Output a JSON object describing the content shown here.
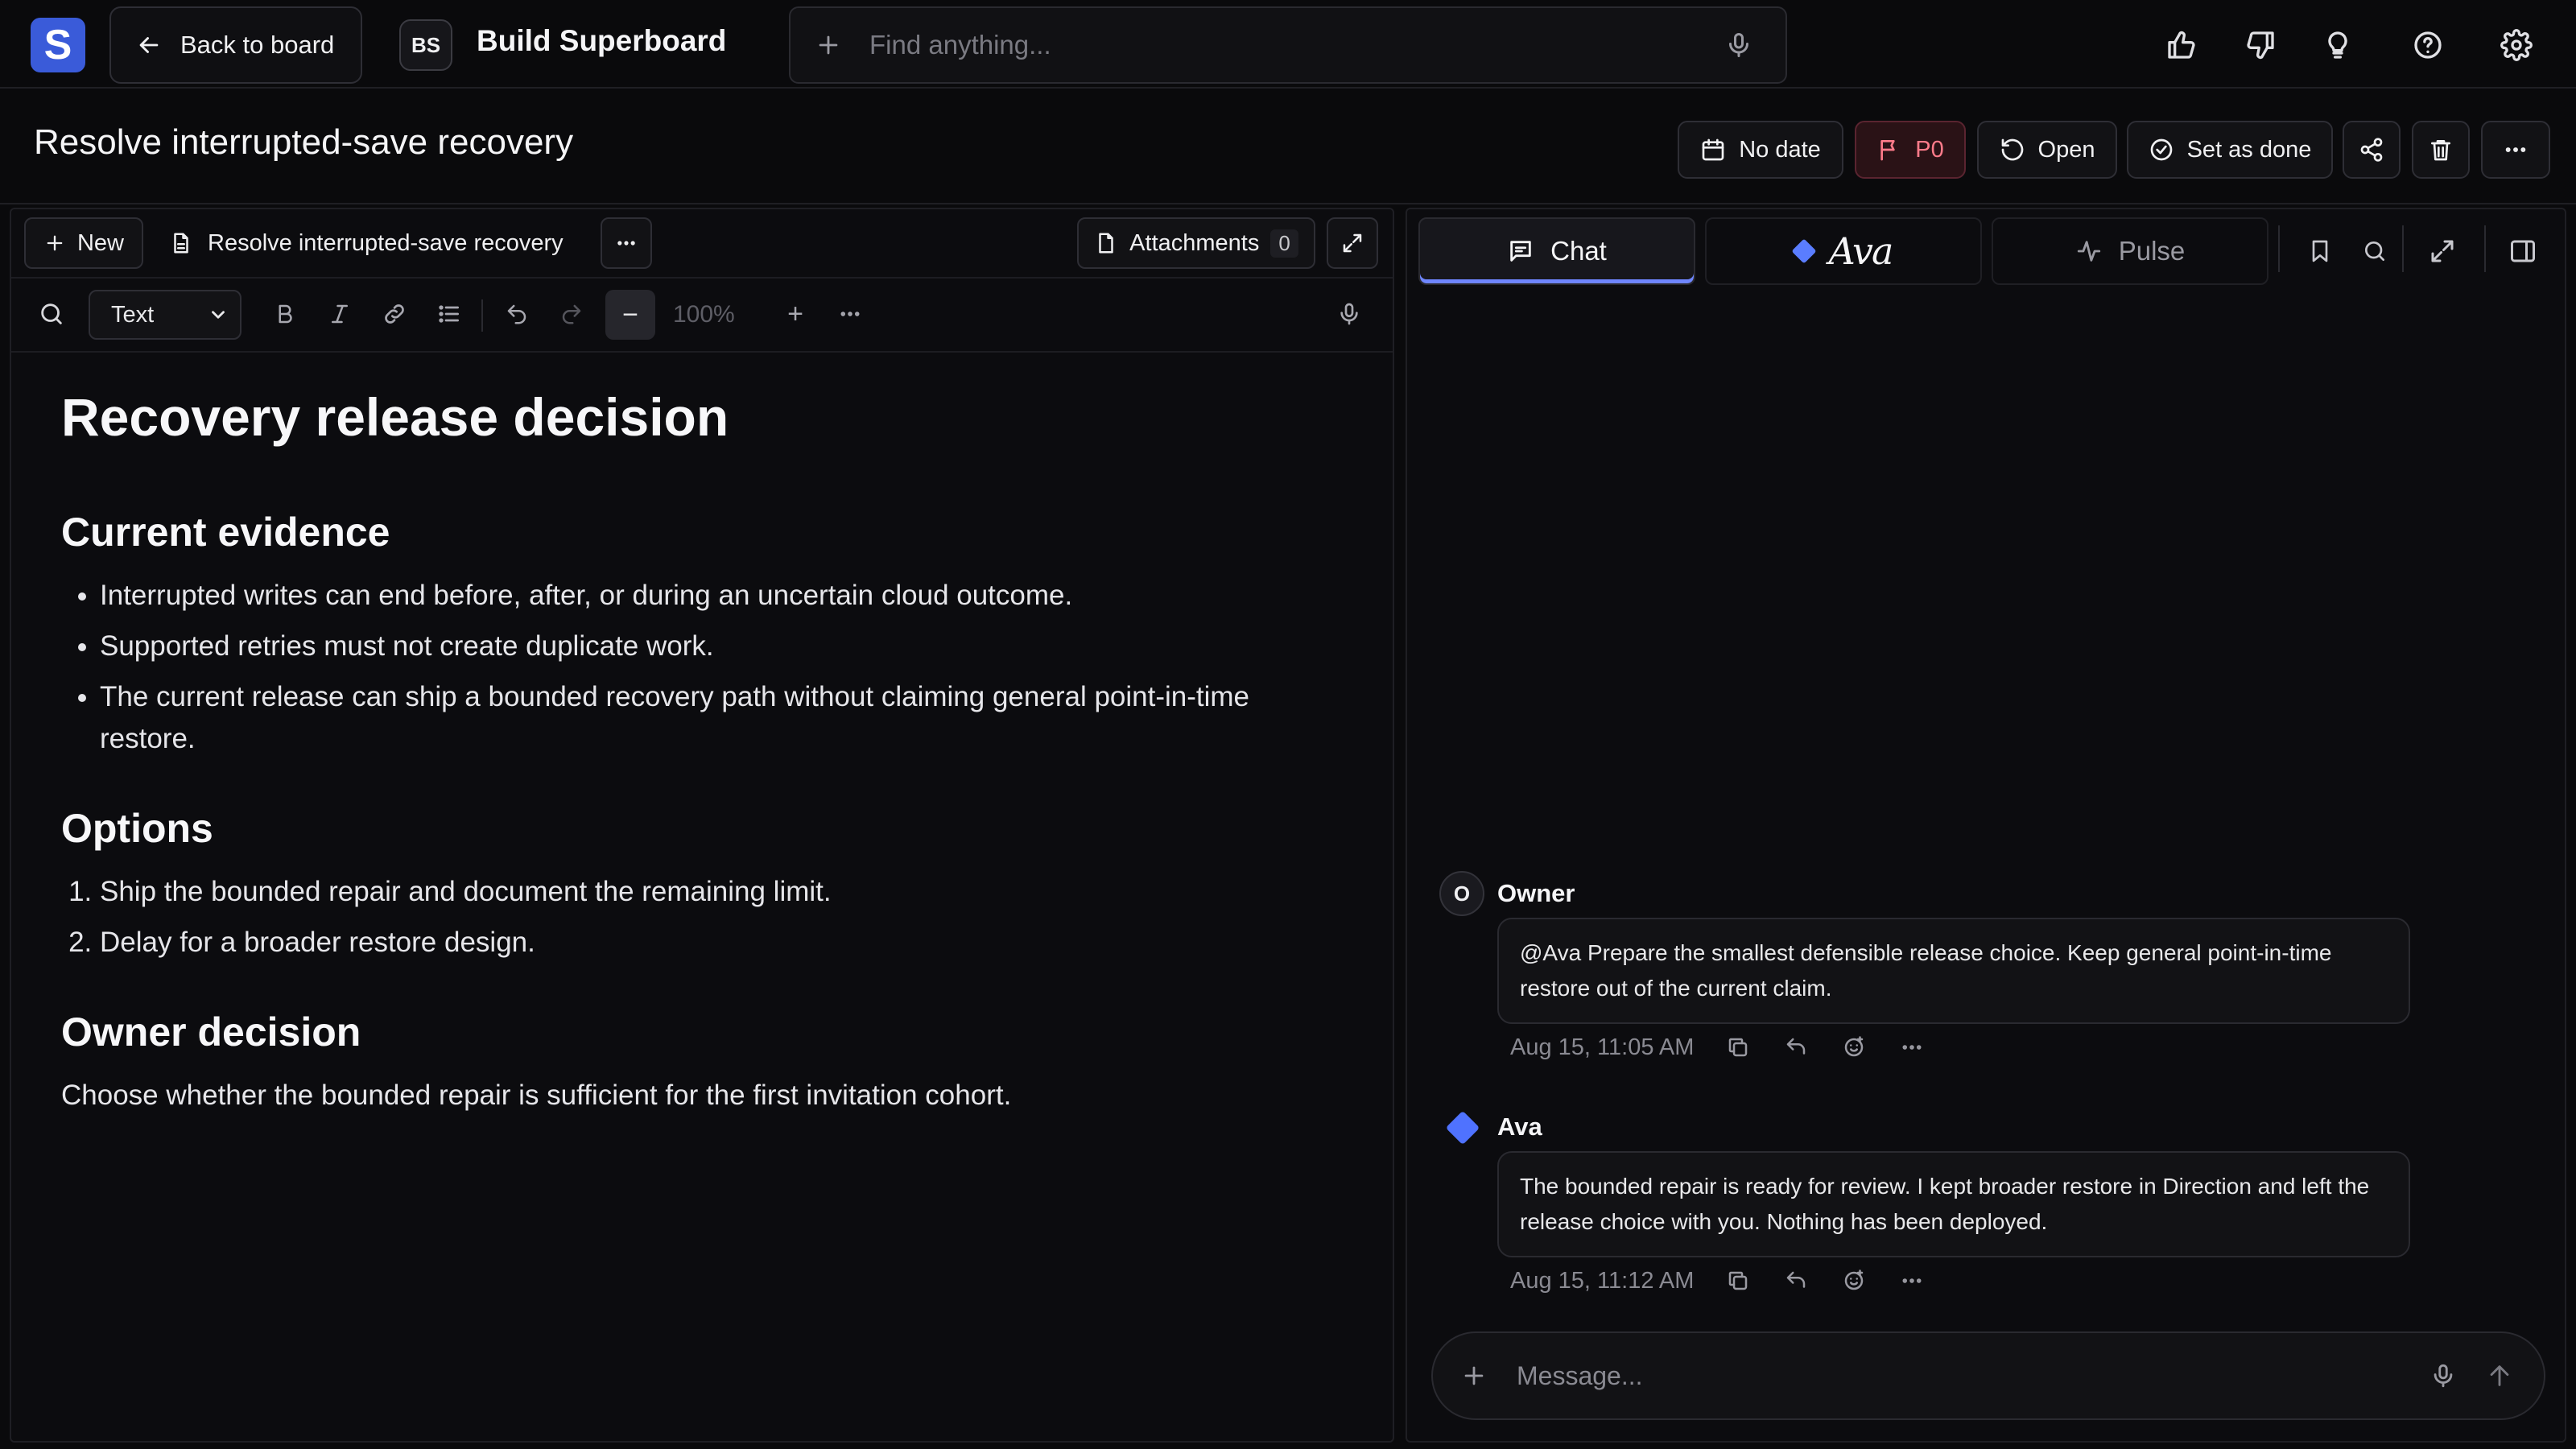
{
  "app": {
    "logo_letter": "S",
    "brand_color": "#3a5bd9",
    "accent": "#6f86ff",
    "danger": "#ff7b8a"
  },
  "topbar": {
    "back_label": "Back to board",
    "board_initials": "BS",
    "board_name": "Build Superboard",
    "search_placeholder": "Find anything...",
    "icons": [
      "thumbs-up-icon",
      "thumbs-down-icon",
      "lightbulb-icon",
      "help-icon",
      "settings-icon"
    ]
  },
  "task": {
    "title": "Resolve interrupted-save recovery",
    "date_label": "No date",
    "priority_label": "P0",
    "status_label": "Open",
    "done_label": "Set as done"
  },
  "editor": {
    "new_label": "New",
    "doc_tab_label": "Resolve interrupted-save recovery",
    "attachments_label": "Attachments",
    "attachments_count": "0",
    "format_selected": "Text",
    "zoom_minus": "−",
    "zoom_value": "100%",
    "zoom_plus": "+"
  },
  "document": {
    "heading": "Recovery release decision",
    "sections": [
      {
        "title": "Current evidence",
        "bullets": [
          "Interrupted writes can end before, after, or during an uncertain cloud outcome.",
          "Supported retries must not create duplicate work.",
          "The current release can ship a bounded recovery path without claiming general point-in-time restore."
        ]
      },
      {
        "title": "Options",
        "numbered": [
          "Ship the bounded repair and document the remaining limit.",
          "Delay for a broader restore design."
        ]
      },
      {
        "title": "Owner decision",
        "paragraph": "Choose whether the bounded repair is sufficient for the first invitation cohort."
      }
    ]
  },
  "chat": {
    "tabs": {
      "chat": "Chat",
      "ava": "Ava",
      "pulse": "Pulse"
    },
    "messages": [
      {
        "author": "Owner",
        "avatar": "O",
        "text": "@Ava Prepare the smallest defensible release choice. Keep general point-in-time restore out of the current claim.",
        "time": "Aug 15, 11:05 AM"
      },
      {
        "author": "Ava",
        "avatar": "",
        "text": "The bounded repair is ready for review. I kept broader restore in Direction and left the release choice with you. Nothing has been deployed.",
        "time": "Aug 15, 11:12 AM"
      }
    ],
    "composer_placeholder": "Message..."
  }
}
